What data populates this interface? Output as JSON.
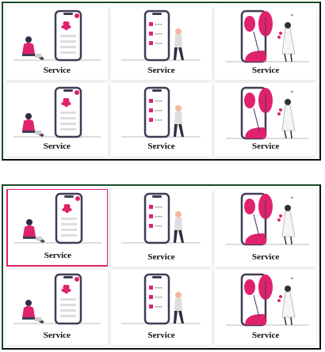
{
  "panels": [
    {
      "cards": [
        {
          "label": "Service",
          "illustration": "woman-phone-illustration"
        },
        {
          "label": "Service",
          "illustration": "man-checklist-illustration"
        },
        {
          "label": "Service",
          "illustration": "woman-plant-illustration"
        },
        {
          "label": "Service",
          "illustration": "woman-phone-illustration"
        },
        {
          "label": "Service",
          "illustration": "man-checklist-illustration"
        },
        {
          "label": "Service",
          "illustration": "woman-plant-illustration"
        }
      ]
    },
    {
      "cards": [
        {
          "label": "Service",
          "illustration": "woman-phone-illustration"
        },
        {
          "label": "Service",
          "illustration": "man-checklist-illustration"
        },
        {
          "label": "Service",
          "illustration": "woman-plant-illustration"
        },
        {
          "label": "Service",
          "illustration": "woman-phone-illustration"
        },
        {
          "label": "Service",
          "illustration": "man-checklist-illustration"
        },
        {
          "label": "Service",
          "illustration": "woman-plant-illustration"
        }
      ]
    }
  ],
  "colors": {
    "accent": "#e0226d",
    "phone_frame": "#3f3d56",
    "border": "#111111"
  }
}
